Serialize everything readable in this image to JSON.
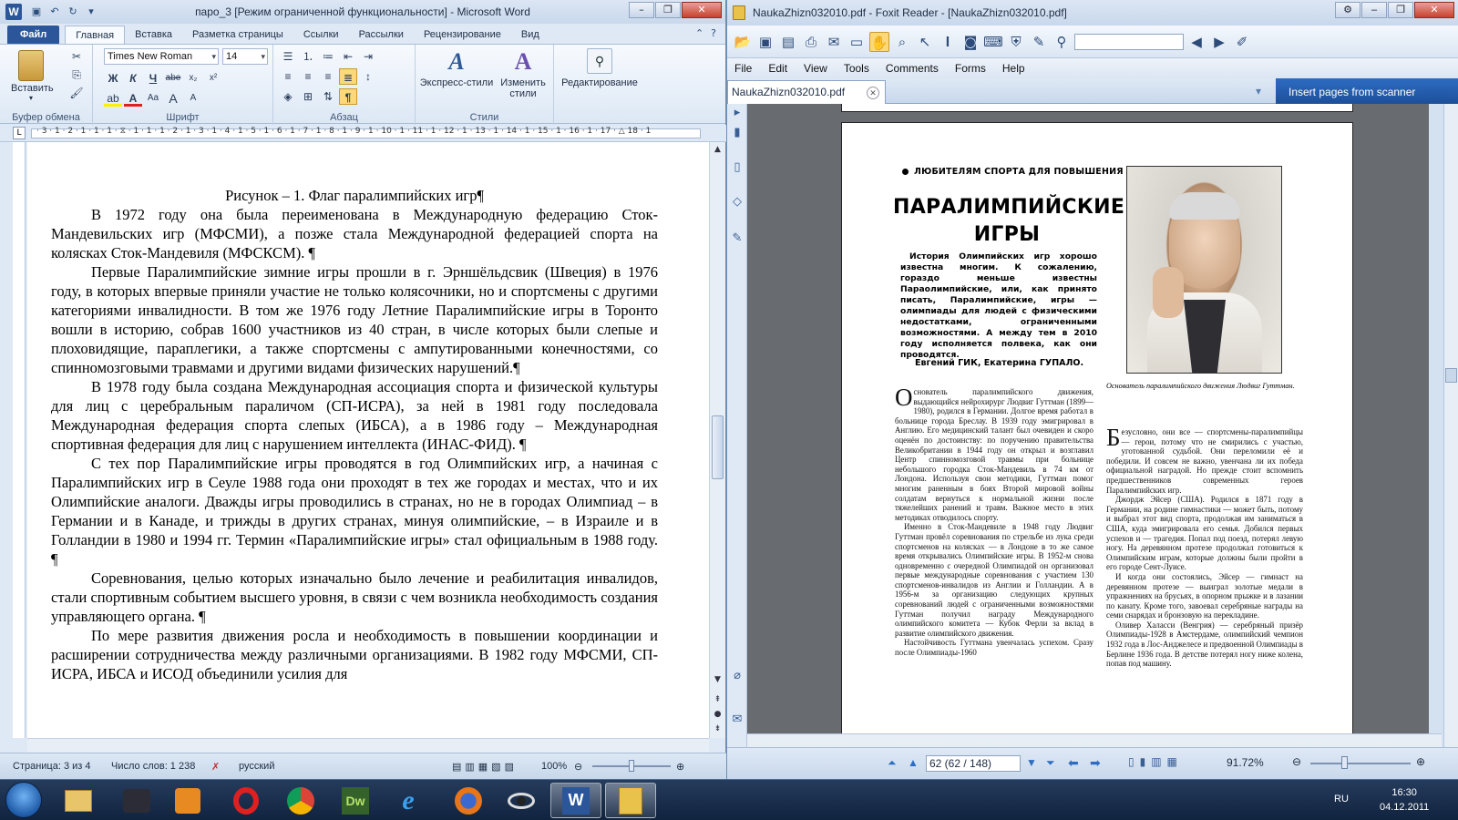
{
  "word": {
    "title": "паро_3 [Режим ограниченной функциональности]  -  Microsoft Word",
    "tabs": {
      "file": "Файл",
      "items": [
        "Главная",
        "Вставка",
        "Разметка страницы",
        "Ссылки",
        "Рассылки",
        "Рецензирование",
        "Вид"
      ]
    },
    "ribbon": {
      "clipboard_label": "Буфер обмена",
      "paste_label": "Вставить",
      "font_label": "Шрифт",
      "font_name": "Times New Roman",
      "font_size": "14",
      "bold": "Ж",
      "italic": "К",
      "underline": "Ч",
      "strike": "abe",
      "sub": "x₂",
      "sup": "x²",
      "grow": "A",
      "shrink": "A",
      "case": "Aa",
      "paragraph_label": "Абзац",
      "pilcrow": "¶",
      "styles_label": "Стили",
      "quick_styles": "Экспресс-стили",
      "change_styles": "Изменить стили",
      "editing_label": "Редактирование"
    },
    "ruler_numbers": "· 3 · 1 · 2 · 1 · 1 · 1 · ⧖ · 1 · 1 · 1 · 2 · 1 · 3 · 1 · 4 · 1 · 5 · 1 · 6 · 1 · 7 · 1 · 8 · 1 · 9 · 1 · 10 · 1 · 11 · 1 · 12 · 1 · 13 · 1 · 14 · 1 · 15 · 1 · 16 · 1 · 17 · △ 18 · 1",
    "document": {
      "caption": "Рисунок – 1. Флаг паралимпийских игр¶",
      "paragraphs": [
        "В 1972 году она была переименована в Международную федерацию Сток-Мандевильских игр (МФСМИ), а позже стала Международной федерацией спорта на колясках Сток-Мандевиля (МФСКСМ). ¶",
        "Первые Паралимпийские зимние игры прошли в г. Эрншёльдсвик (Швеция) в 1976 году, в которых впервые приняли участие не только колясочники, но и спортсмены с другими категориями инвалидности. В том же 1976 году Летние Паралимпийские игры в Торонто вошли в историю, собрав 1600 участников из 40 стран, в числе которых были слепые и плоховидящие, параплегики, а также спортсмены с ампутированными конечностями, со спинномозговыми травмами и другими видами физических нарушений.¶",
        "В 1978 году была создана Международная ассоциация спорта и физической культуры для лиц с церебральным параличом (СП-ИСРА), за ней в 1981 году последовала Международная федерация спорта слепых (ИБСА), а в 1986 году – Международная спортивная федерация для лиц с нарушением интеллекта (ИНАС-ФИД). ¶",
        "С тех пор Паралимпийские игры проводятся в год Олимпийских игр, а начиная с Паралимпийских игр в Сеуле 1988 года они проходят в тех же городах и местах, что и их Олимпийские аналоги. Дважды игры проводились в странах, но не в городах Олимпиад – в Германии и в Канаде, и трижды в других странах, минуя олимпийские, – в Израиле и в Голландии в 1980 и 1994 гг. Термин «Паралимпийские игры» стал официальным в 1988 году. ¶",
        "Соревнования, целью которых изначально было лечение и реабилитация инвалидов, стали спортивным событием высшего уровня, в связи с чем возникла необходимость создания управляющего органа. ¶",
        "По мере развития движения росла и необходимость в повышении координации и расширении сотрудничества между различными организациями. В 1982 году МФСМИ, СП-ИСРА, ИБСА и ИСОД объединили усилия для"
      ]
    },
    "status": {
      "page": "Страница: 3 из 4",
      "words": "Число слов: 1 238",
      "lang": "русский",
      "zoom": "100%"
    }
  },
  "foxit": {
    "title": "NaukaZhizn032010.pdf - Foxit Reader - [NaukaZhizn032010.pdf]",
    "menu": [
      "File",
      "Edit",
      "View",
      "Tools",
      "Comments",
      "Forms",
      "Help"
    ],
    "doc_tab": "NaukaZhizn032010.pdf",
    "banner": "Insert pages from scanner",
    "page_input": "62 (62 / 148)",
    "zoom": "91.72%",
    "pdf": {
      "kicker": "ЛЮБИТЕЛЯМ СПОРТА ДЛЯ ПОВЫШЕНИЯ ЭРУДИЦИИ",
      "title": "ПАРАЛИМПИЙСКИЕ ИГРЫ",
      "lead": "История Олимпийских игр хорошо известна многим. К сожалению, гораздо меньше известны Параолимпийские, или, как принято писать, Паралимпийские, игры — олимпиады для людей с физическими недостатками, ограниченными возможностями. А между тем в 2010 году исполняется полвека, как они проводятся.",
      "authors": "Евгений ГИК, Екатерина ГУПАЛО.",
      "caption": "Основатель паралимпийского движения Людвиг Гуттман.",
      "col1_drop": "О",
      "col1_p1": "снователь паралимпийского движения, выдающийся нейрохирург Людвиг Гуттман (1899—1980), родился в Германии. Долгое время работал в больнице города Бреслау. В 1939 году эмигрировал в Англию. Его медицинский талант был очевиден и скоро оценён по достоинству: по поручению правительства Великобритании в 1944 году он открыл и возглавил Центр спинномозговой травмы при больнице небольшого городка Сток-Мандевиль в 74 км от Лондона. Используя свои методики, Гуттман помог многим раненным в боях Второй мировой войны солдатам вернуться к нормальной жизни после тяжелейших ранений и травм. Важное место в этих методиках отводилось спорту.",
      "col1_p2": "Именно в Сток-Мандевиле в 1948 году Людвиг Гуттман провёл соревнования по стрельбе из лука среди спортсменов на колясках — в Лондоне в то же самое время открывались Олимпийские игры. В 1952-м снова одновременно с очередной Олимпиадой он организовал первые международные соревнования с участием 130 спортсменов-инвалидов из Англии и Голландии. А в 1956-м за организацию следующих крупных соревнований людей с ограниченными возможностями Гуттман получил награду Международного олимпийского комитета — Кубок Ферли за вклад в развитие олимпийского движения.",
      "col1_p3": "Настойчивость Гуттмана увенчалась успехом. Сразу после Олимпиады-1960",
      "col2_drop": "Б",
      "col2_p1": "езусловно, они все — спортсмены-паралимпийцы — герои, потому что не смирились с участью, уготованной судьбой. Они переломили её и победили. И совсем не важно, увенчана ли их победа официальной наградой. Но прежде стоит вспомнить предшественников современных героев Паралимпийских игр.",
      "col2_p2": "Джордж Эйсер (США). Родился в 1871 году в Германии, на родине гимнастики — может быть, потому и выбрал этот вид спорта, продолжая им заниматься в США, куда эмигрировала его семья. Добился первых успехов и — трагедия. Попал под поезд, потерял левую ногу. На деревянном протезе продолжал готовиться к Олимпийским играм, которые должны были пройти в его городе Сент-Луисе.",
      "col2_p3": "И когда они состоялись, Эйсер — гимнаст на деревянном протезе — выиграл золотые медали в упражнениях на брусьях, в опорном прыжке и в лазании по канату. Кроме того, завоевал серебряные награды на семи снарядах и бронзовую на перекладине.",
      "col2_p4": "Оливер Халасси (Венгрия) — серебряный призёр Олимпиады-1928 в Амстердаме, олимпийский чемпион 1932 года в Лос-Анджелесе и предвоенной Олимпиады в Берлине 1936 года. В детстве потерял ногу ниже колена, попав под машину."
    }
  },
  "taskbar": {
    "lang": "RU",
    "time": "16:30",
    "date": "04.12.2011",
    "apps": [
      "explorer",
      "kmplayer",
      "media",
      "opera",
      "chrome",
      "dreamweaver",
      "ie",
      "firefox",
      "vlc-eye",
      "word",
      "foxit"
    ],
    "word_letter": "W",
    "dw_label": "Dw"
  },
  "colors": {
    "word_blue": "#2b579a",
    "ribbon_bg": "#dfe9f5",
    "foxit_banner": "#1d4f99",
    "taskbar": "#10233f"
  }
}
